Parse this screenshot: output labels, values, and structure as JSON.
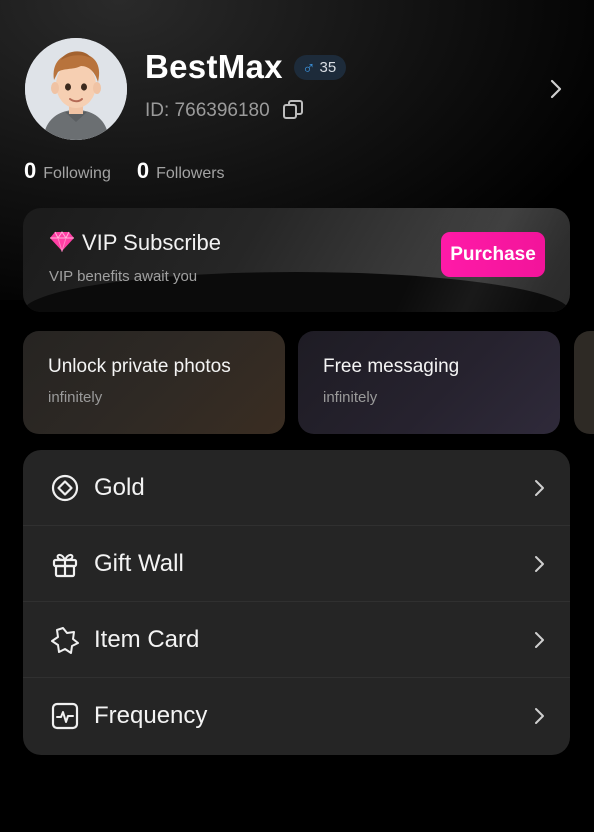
{
  "profile": {
    "username": "BestMax",
    "gender_symbol": "♂",
    "age": "35",
    "user_id": "ID: 766396180"
  },
  "stats": {
    "following_count": "0",
    "following_label": "Following",
    "followers_count": "0",
    "followers_label": "Followers"
  },
  "vip": {
    "title": "VIP Subscribe",
    "subtitle": "VIP benefits await you",
    "purchase_label": "Purchase"
  },
  "benefits": [
    {
      "title": "Unlock private photos",
      "subtitle": "infinitely"
    },
    {
      "title": "Free messaging",
      "subtitle": "infinitely"
    }
  ],
  "menu": [
    {
      "label": "Gold",
      "icon": "gold-coin-icon"
    },
    {
      "label": "Gift Wall",
      "icon": "gift-icon"
    },
    {
      "label": "Item Card",
      "icon": "item-card-icon"
    },
    {
      "label": "Frequency",
      "icon": "frequency-icon"
    }
  ],
  "colors": {
    "accent": "#ff1aa8",
    "male_blue": "#3d95e0",
    "background": "#000000",
    "menu_panel": "#252525"
  }
}
